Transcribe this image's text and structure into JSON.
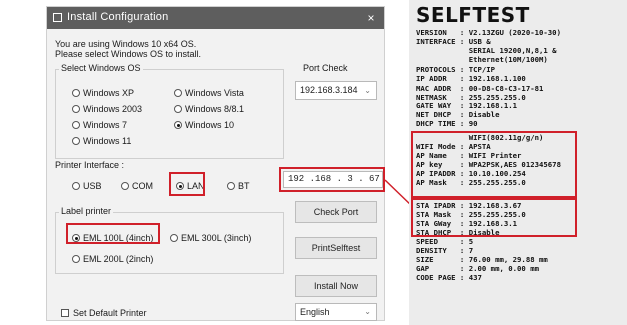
{
  "dialog": {
    "title": "Install Configuration",
    "close_glyph": "×",
    "os_intro": "You are using Windows 10 x64 OS.\nPlease select Windows OS to install.",
    "os_group_label": "Select Windows OS",
    "os_options": [
      {
        "label": "Windows XP",
        "selected": false
      },
      {
        "label": "Windows Vista",
        "selected": false
      },
      {
        "label": "Windows 2003",
        "selected": false
      },
      {
        "label": "Windows 8/8.1",
        "selected": false
      },
      {
        "label": "Windows 7",
        "selected": false
      },
      {
        "label": "Windows 10",
        "selected": true
      },
      {
        "label": "Windows 11",
        "selected": false
      }
    ],
    "port_check_label": "Port Check",
    "port_check_value": "192.168.3.184",
    "printer_interface_label": "Printer Interface :",
    "interfaces": [
      {
        "label": "USB",
        "selected": false
      },
      {
        "label": "COM",
        "selected": false
      },
      {
        "label": "LAN",
        "selected": true
      },
      {
        "label": "BT",
        "selected": false
      }
    ],
    "ip_value": "192 .168 . 3  . 67",
    "label_printer_label": "Label printer",
    "printers": [
      {
        "label": "EML 100L (4inch)",
        "selected": true
      },
      {
        "label": "EML 300L (3inch)",
        "selected": false
      },
      {
        "label": "EML 200L (2inch)",
        "selected": false
      }
    ],
    "check_port_button": "Check Port",
    "print_selftest_button": "PrintSelftest",
    "install_now_button": "Install Now",
    "set_default_label": "Set Default Printer",
    "set_default_checked": false,
    "language_value": "English",
    "highlight_color": "#d0202a"
  },
  "selftest": {
    "title": "SELFTEST",
    "lines": [
      "VERSION   : V2.13ZGU (2020-10-30)",
      "INTERFACE : USB &",
      "            SERIAL 19200,N,8,1 &",
      "            Ethernet(10M/100M)",
      "PROTOCOLS : TCP/IP",
      "IP ADDR   : 192.168.1.100",
      "MAC ADDR  : 00-D8-C8-C3-17-81",
      "NETMASK   : 255.255.255.0",
      "GATE WAY  : 192.168.1.1",
      "NET DHCP  : Disable",
      "DHCP TIME : 90",
      "            WIFI(802.11g/g/n)",
      "WIFI Mode : APSTA",
      "AP Name   : WIFI Printer",
      "AP key    : WPA2PSK,AES 012345678",
      "AP IPADDR : 10.10.100.254",
      "AP Mask   : 255.255.255.0",
      "",
      "STA IPADR : 192.168.3.67",
      "STA Mask  : 255.255.255.0",
      "STA GWay  : 192.168.3.1",
      "STA DHCP  : Disable",
      "SPEED     : 5",
      "DENSITY   : 7",
      "SIZE      : 76.00 mm, 29.88 mm",
      "GAP       : 2.00 mm, 0.00 mm",
      "CODE PAGE : 437"
    ]
  }
}
